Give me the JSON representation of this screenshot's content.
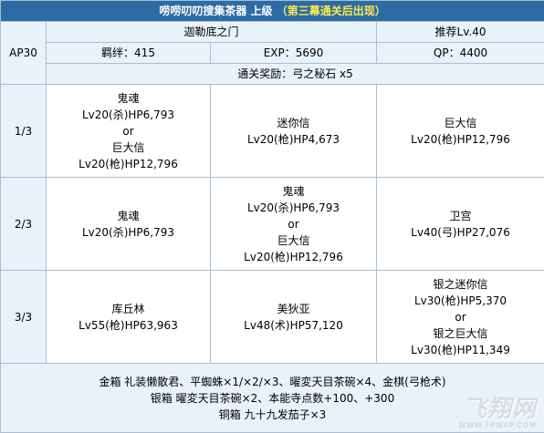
{
  "header": {
    "title": "唠唠叨叨搜集茶器 上级",
    "subtitle": "（第三幕通关后出现）"
  },
  "info": {
    "ap": "AP30",
    "location": "迦勒底之门",
    "recommended": "推荐Lv.40",
    "bond": "羁绊：415",
    "exp": "EXP：5690",
    "qp": "QP：4400",
    "reward": "通关奖励：弓之秘石 x5"
  },
  "waves": [
    {
      "label": "1/3",
      "enemies": [
        [
          "鬼魂",
          "Lv20(杀)HP6,793",
          "or",
          "巨大信",
          "Lv20(枪)HP12,796"
        ],
        [
          "迷你信",
          "Lv20(枪)HP4,673"
        ],
        [
          "巨大信",
          "Lv20(枪)HP12,796"
        ]
      ]
    },
    {
      "label": "2/3",
      "enemies": [
        [
          "鬼魂",
          "Lv20(杀)HP6,793"
        ],
        [
          "鬼魂",
          "Lv20(杀)HP6,793",
          "or",
          "巨大信",
          "Lv20(枪)HP12,796"
        ],
        [
          "卫宫",
          "Lv40(弓)HP27,076"
        ]
      ]
    },
    {
      "label": "3/3",
      "enemies": [
        [
          "库丘林",
          "Lv55(枪)HP63,963"
        ],
        [
          "美狄亚",
          "Lv48(术)HP57,120"
        ],
        [
          "银之迷你信",
          "Lv30(枪)HP5,370",
          "or",
          "银之巨大信",
          "Lv30(枪)HP11,349"
        ]
      ]
    }
  ],
  "drops": {
    "gold": "金箱 礼装懒散君、平蜘蛛×1/×2/×3、曜変天目茶碗×4、金棋(弓枪术)",
    "silver": "银箱 曜変天目茶碗×2、本能寺点数+100、+300",
    "bronze": "铜箱 九十九发茄子×3"
  },
  "watermark": {
    "logo": "飞翔网",
    "url": "WWW.FPWAP.COM"
  },
  "colors": {
    "header_bg": "#2d6ba4",
    "header_text": "#ffffff",
    "header_sub": "#ffe84f",
    "info_bg": "#e9f1fb",
    "border": "#a9bdd3"
  }
}
